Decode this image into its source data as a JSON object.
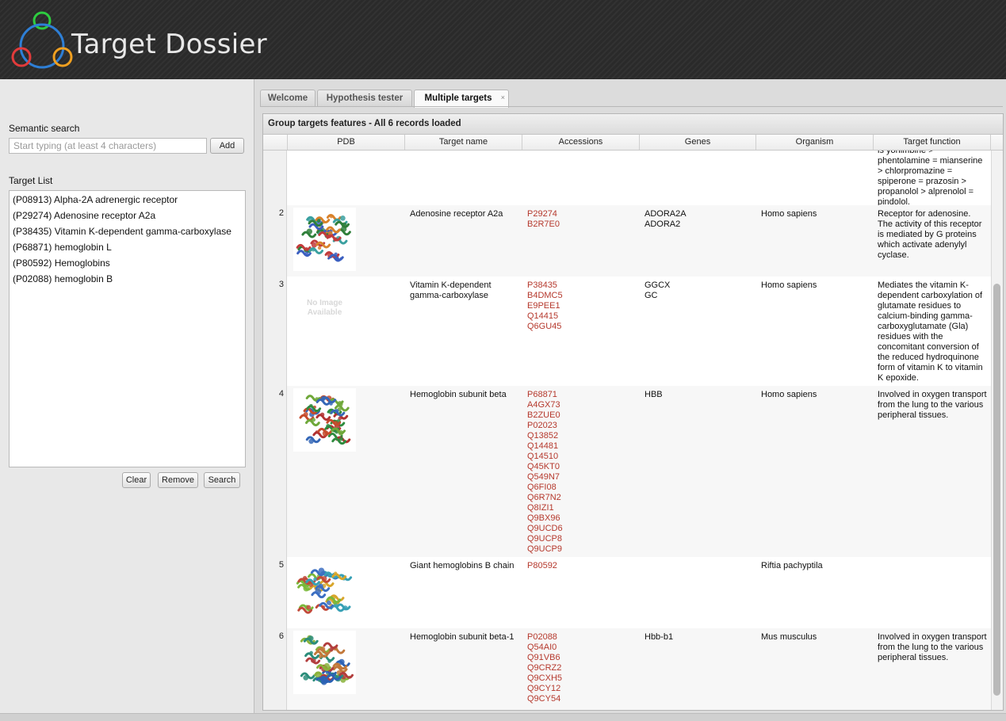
{
  "app": {
    "title": "Target Dossier"
  },
  "sidebar": {
    "semantic_search_label": "Semantic search",
    "search_placeholder": "Start typing (at least 4 characters)",
    "add_label": "Add",
    "target_list_label": "Target List",
    "targets": [
      "(P08913) Alpha-2A adrenergic receptor",
      "(P29274) Adenosine receptor A2a",
      "(P38435) Vitamin K-dependent gamma-carboxylase",
      "(P68871) hemoglobin L",
      "(P80592) Hemoglobins",
      "(P02088) hemoglobin B"
    ],
    "clear_label": "Clear",
    "remove_label": "Remove",
    "search_label": "Search"
  },
  "tabs": [
    {
      "label": "Welcome"
    },
    {
      "label": "Hypothesis tester"
    },
    {
      "label": "Multiple targets",
      "close": "×"
    }
  ],
  "grid": {
    "title": "Group targets features - All 6 records loaded",
    "columns": [
      "PDB",
      "Target name",
      "Accessions",
      "Genes",
      "Organism",
      "Target function"
    ],
    "no_image_text": "No Image Available",
    "rows": [
      {
        "num": "",
        "name": "",
        "accessions": [],
        "genes": [],
        "organism": "",
        "function": "is yohimbine > phentolamine = mianserine > chlorpromazine = spiperone = prazosin > propanolol > alprenolol = pindolol.",
        "image": "none"
      },
      {
        "num": "2",
        "name": "Adenosine receptor A2a",
        "accessions": [
          "P29274",
          "B2R7E0"
        ],
        "genes": [
          "ADORA2A",
          "ADORA2"
        ],
        "organism": "Homo sapiens",
        "function": "Receptor for adenosine. The activity of this receptor is mediated by G proteins which activate adenylyl cyclase.",
        "image": "structure-a"
      },
      {
        "num": "3",
        "name": "Vitamin K-dependent gamma-carboxylase",
        "accessions": [
          "P38435",
          "B4DMC5",
          "E9PEE1",
          "Q14415",
          "Q6GU45"
        ],
        "genes": [
          "GGCX",
          "GC"
        ],
        "organism": "Homo sapiens",
        "function": "Mediates the vitamin K-dependent carboxylation of glutamate residues to calcium-binding gamma-carboxyglutamate (Gla) residues with the concomitant conversion of the reduced hydroquinone form of vitamin K to vitamin K epoxide.",
        "image": "noimage"
      },
      {
        "num": "4",
        "name": "Hemoglobin subunit beta",
        "accessions": [
          "P68871",
          "A4GX73",
          "B2ZUE0",
          "P02023",
          "Q13852",
          "Q14481",
          "Q14510",
          "Q45KT0",
          "Q549N7",
          "Q6FI08",
          "Q6R7N2",
          "Q8IZI1",
          "Q9BX96",
          "Q9UCD6",
          "Q9UCP8",
          "Q9UCP9"
        ],
        "genes": [
          "HBB"
        ],
        "organism": "Homo sapiens",
        "function": "Involved in oxygen transport from the lung to the various peripheral tissues.",
        "image": "structure-b"
      },
      {
        "num": "5",
        "name": "Giant hemoglobins B chain",
        "accessions": [
          "P80592"
        ],
        "genes": [],
        "organism": "Riftia pachyptila",
        "function": "",
        "image": "structure-c"
      },
      {
        "num": "6",
        "name": "Hemoglobin subunit beta-1",
        "accessions": [
          "P02088",
          "Q54AI0",
          "Q91VB6",
          "Q9CRZ2",
          "Q9CXH5",
          "Q9CY12",
          "Q9CY54"
        ],
        "genes": [
          "Hbb-b1"
        ],
        "organism": "Mus musculus",
        "function": "Involved in oxygen transport from the lung to the various peripheral tissues.",
        "image": "structure-d"
      }
    ]
  }
}
